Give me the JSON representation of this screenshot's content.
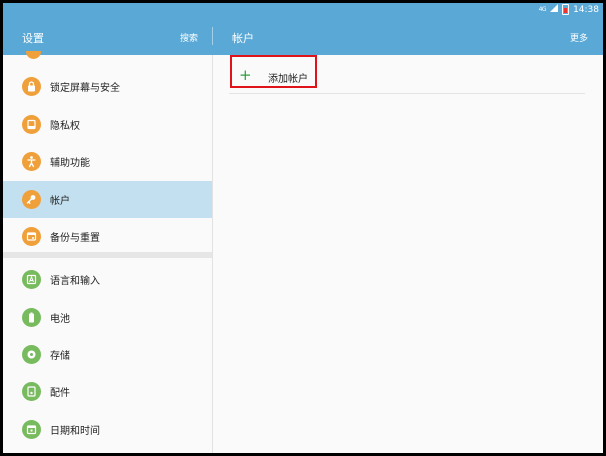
{
  "status_bar": {
    "signal": "4G",
    "time": "14:38"
  },
  "app_bar": {
    "title": "设置",
    "search_label": "搜索",
    "detail_title": "帐户",
    "more_label": "更多"
  },
  "sidebar": {
    "items": [
      {
        "label": "锁定屏幕与安全",
        "icon": "lock-icon",
        "color": "#f0a03a"
      },
      {
        "label": "隐私权",
        "icon": "privacy-icon",
        "color": "#f0a03a"
      },
      {
        "label": "辅助功能",
        "icon": "accessibility-icon",
        "color": "#f0a03a"
      },
      {
        "label": "帐户",
        "icon": "key-icon",
        "color": "#f0a03a",
        "selected": true
      },
      {
        "label": "备份与重置",
        "icon": "backup-icon",
        "color": "#f0a03a"
      },
      {
        "label": "语言和输入",
        "icon": "language-icon",
        "color": "#78bb5f"
      },
      {
        "label": "电池",
        "icon": "battery-icon",
        "color": "#78bb5f"
      },
      {
        "label": "存储",
        "icon": "storage-icon",
        "color": "#78bb5f"
      },
      {
        "label": "配件",
        "icon": "accessory-icon",
        "color": "#78bb5f"
      },
      {
        "label": "日期和时间",
        "icon": "calendar-icon",
        "color": "#78bb5f"
      }
    ]
  },
  "content": {
    "add_account_label": "添加帐户"
  },
  "colors": {
    "appbar": "#5aa8d6",
    "selected": "#c2e0ef",
    "highlight": "#e0131a"
  }
}
